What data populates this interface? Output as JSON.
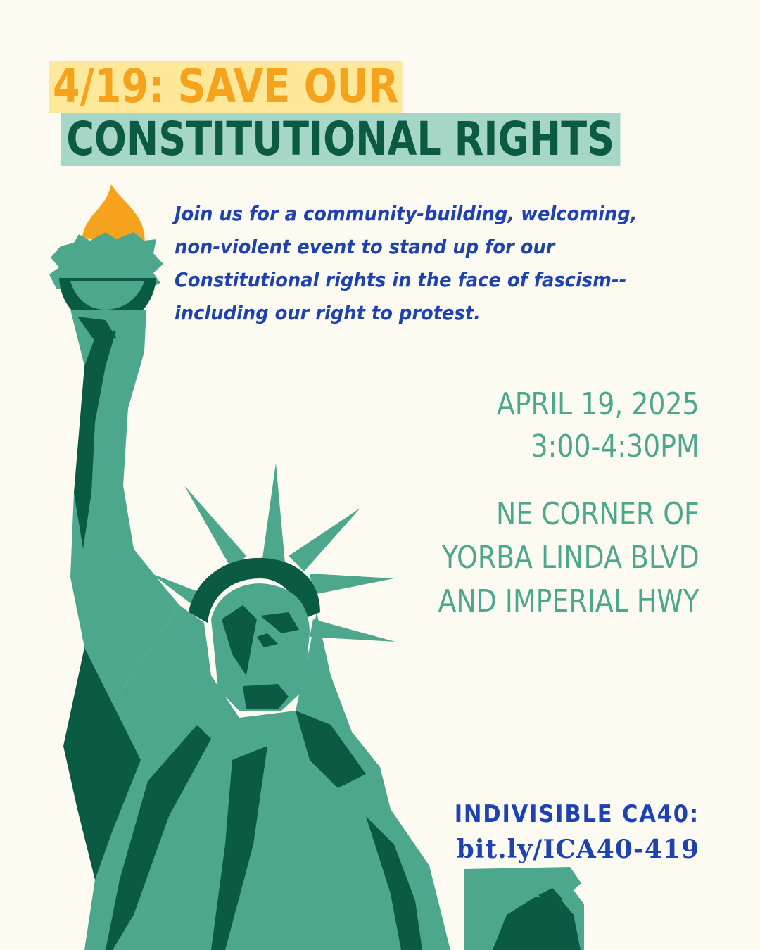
{
  "title": {
    "line1": "4/19: SAVE OUR",
    "line2": "CONSTITUTIONAL RIGHTS"
  },
  "description": {
    "lines": [
      "Join us for a community-building, welcoming,",
      "non-violent event to stand up for our",
      "Constitutional rights in the face of fascism--",
      "including our right to protest."
    ]
  },
  "event": {
    "date": "APRIL 19, 2025",
    "time": "3:00-4:30PM",
    "location_lines": [
      "NE CORNER OF",
      "YORBA LINDA BLVD",
      "AND IMPERIAL HWY"
    ]
  },
  "organizer": {
    "name": "INDIVISIBLE CA40:",
    "link": "bit.ly/ICA40-419"
  },
  "illustration": {
    "subject": "statue-of-liberty-icon",
    "colors": {
      "background": "#fdfbf1",
      "statue_light": "#4ca78c",
      "statue_dark": "#0b5a43",
      "flame": "#f5a31c",
      "title_highlight_yellow": "#ffe89a",
      "title_highlight_green": "#a6d6c5",
      "text_blue": "#1e43b0"
    }
  }
}
